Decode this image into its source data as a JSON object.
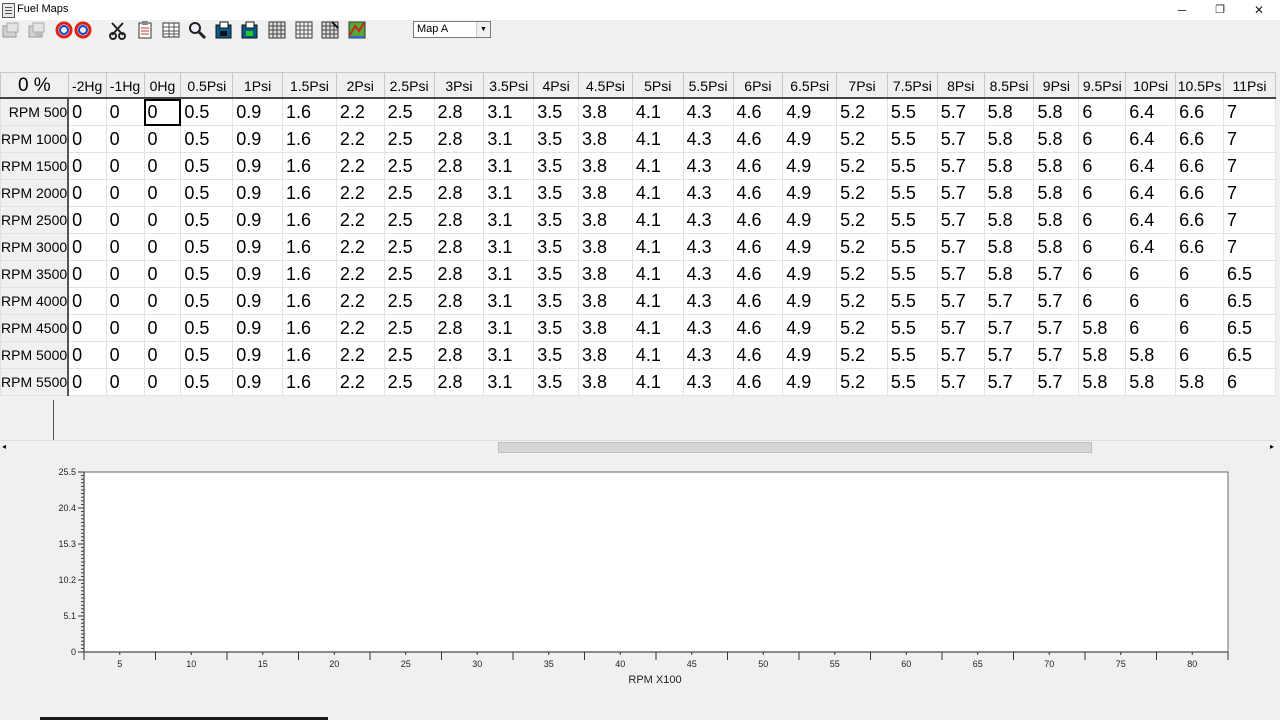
{
  "window": {
    "title": "Fuel Maps",
    "minimize": "─",
    "restore": "❐",
    "close": "✕"
  },
  "toolbar": {
    "icons": [
      "open-file-disabled-icon",
      "save-file-disabled-icon",
      "link-icon",
      "cut-icon",
      "clipboard-icon",
      "table-icon",
      "magnifier-icon",
      "load-map-icon",
      "save-map-icon",
      "grid-view-icon",
      "grid-icon",
      "grid-edit-icon",
      "chart-3d-icon"
    ],
    "map_select": {
      "value": "Map A",
      "arrow": "▼"
    }
  },
  "grid": {
    "corner": "0 %",
    "columns": [
      "-2Hg",
      "-1Hg",
      "0Hg",
      "0.5Psi",
      "1Psi",
      "1.5Psi",
      "2Psi",
      "2.5Psi",
      "3Psi",
      "3.5Psi",
      "4Psi",
      "4.5Psi",
      "5Psi",
      "5.5Psi",
      "6Psi",
      "6.5Psi",
      "7Psi",
      "7.5Psi",
      "8Psi",
      "8.5Psi",
      "9Psi",
      "9.5Psi",
      "10Psi",
      "10.5Ps",
      "11Psi"
    ],
    "rows": [
      {
        "label": "500 RPM",
        "values": [
          "0",
          "0",
          "0",
          "0.5",
          "0.9",
          "1.6",
          "2.2",
          "2.5",
          "2.8",
          "3.1",
          "3.5",
          "3.8",
          "4.1",
          "4.3",
          "4.6",
          "4.9",
          "5.2",
          "5.5",
          "5.7",
          "5.8",
          "5.8",
          "6",
          "6.4",
          "6.6",
          "7"
        ]
      },
      {
        "label": "1000 RPM",
        "values": [
          "0",
          "0",
          "0",
          "0.5",
          "0.9",
          "1.6",
          "2.2",
          "2.5",
          "2.8",
          "3.1",
          "3.5",
          "3.8",
          "4.1",
          "4.3",
          "4.6",
          "4.9",
          "5.2",
          "5.5",
          "5.7",
          "5.8",
          "5.8",
          "6",
          "6.4",
          "6.6",
          "7"
        ]
      },
      {
        "label": "1500 RPM",
        "values": [
          "0",
          "0",
          "0",
          "0.5",
          "0.9",
          "1.6",
          "2.2",
          "2.5",
          "2.8",
          "3.1",
          "3.5",
          "3.8",
          "4.1",
          "4.3",
          "4.6",
          "4.9",
          "5.2",
          "5.5",
          "5.7",
          "5.8",
          "5.8",
          "6",
          "6.4",
          "6.6",
          "7"
        ]
      },
      {
        "label": "2000 RPM",
        "values": [
          "0",
          "0",
          "0",
          "0.5",
          "0.9",
          "1.6",
          "2.2",
          "2.5",
          "2.8",
          "3.1",
          "3.5",
          "3.8",
          "4.1",
          "4.3",
          "4.6",
          "4.9",
          "5.2",
          "5.5",
          "5.7",
          "5.8",
          "5.8",
          "6",
          "6.4",
          "6.6",
          "7"
        ]
      },
      {
        "label": "2500 RPM",
        "values": [
          "0",
          "0",
          "0",
          "0.5",
          "0.9",
          "1.6",
          "2.2",
          "2.5",
          "2.8",
          "3.1",
          "3.5",
          "3.8",
          "4.1",
          "4.3",
          "4.6",
          "4.9",
          "5.2",
          "5.5",
          "5.7",
          "5.8",
          "5.8",
          "6",
          "6.4",
          "6.6",
          "7"
        ]
      },
      {
        "label": "3000 RPM",
        "values": [
          "0",
          "0",
          "0",
          "0.5",
          "0.9",
          "1.6",
          "2.2",
          "2.5",
          "2.8",
          "3.1",
          "3.5",
          "3.8",
          "4.1",
          "4.3",
          "4.6",
          "4.9",
          "5.2",
          "5.5",
          "5.7",
          "5.8",
          "5.8",
          "6",
          "6.4",
          "6.6",
          "7"
        ]
      },
      {
        "label": "3500 RPM",
        "values": [
          "0",
          "0",
          "0",
          "0.5",
          "0.9",
          "1.6",
          "2.2",
          "2.5",
          "2.8",
          "3.1",
          "3.5",
          "3.8",
          "4.1",
          "4.3",
          "4.6",
          "4.9",
          "5.2",
          "5.5",
          "5.7",
          "5.8",
          "5.7",
          "6",
          "6",
          "6",
          "6.5"
        ]
      },
      {
        "label": "4000 RPM",
        "values": [
          "0",
          "0",
          "0",
          "0.5",
          "0.9",
          "1.6",
          "2.2",
          "2.5",
          "2.8",
          "3.1",
          "3.5",
          "3.8",
          "4.1",
          "4.3",
          "4.6",
          "4.9",
          "5.2",
          "5.5",
          "5.7",
          "5.7",
          "5.7",
          "6",
          "6",
          "6",
          "6.5"
        ]
      },
      {
        "label": "4500 RPM",
        "values": [
          "0",
          "0",
          "0",
          "0.5",
          "0.9",
          "1.6",
          "2.2",
          "2.5",
          "2.8",
          "3.1",
          "3.5",
          "3.8",
          "4.1",
          "4.3",
          "4.6",
          "4.9",
          "5.2",
          "5.5",
          "5.7",
          "5.7",
          "5.7",
          "5.8",
          "6",
          "6",
          "6.5"
        ]
      },
      {
        "label": "5000 RPM",
        "values": [
          "0",
          "0",
          "0",
          "0.5",
          "0.9",
          "1.6",
          "2.2",
          "2.5",
          "2.8",
          "3.1",
          "3.5",
          "3.8",
          "4.1",
          "4.3",
          "4.6",
          "4.9",
          "5.2",
          "5.5",
          "5.7",
          "5.7",
          "5.7",
          "5.8",
          "5.8",
          "6",
          "6.5"
        ]
      },
      {
        "label": "5500 RPM",
        "values": [
          "0",
          "0",
          "0",
          "0.5",
          "0.9",
          "1.6",
          "2.2",
          "2.5",
          "2.8",
          "3.1",
          "3.5",
          "3.8",
          "4.1",
          "4.3",
          "4.6",
          "4.9",
          "5.2",
          "5.5",
          "5.7",
          "5.7",
          "5.7",
          "5.8",
          "5.8",
          "5.8",
          "6"
        ]
      }
    ],
    "selected": {
      "row": 0,
      "col": 2
    }
  },
  "scrollbar": {
    "left_arrow": "◂",
    "right_arrow": "▸"
  },
  "chart_data": {
    "type": "line",
    "title": "",
    "xlabel": "RPM X100",
    "ylabel": "",
    "x_ticks": [
      5,
      10,
      15,
      20,
      25,
      30,
      35,
      40,
      45,
      50,
      55,
      60,
      65,
      70,
      75,
      80
    ],
    "y_ticks": [
      0,
      5.1,
      10.2,
      15.3,
      20.4,
      25.5
    ],
    "ylim": [
      0,
      25.5
    ],
    "series": []
  },
  "colors": {
    "background": "#f0f0f0",
    "cell": "#ffffff",
    "grid_line": "#e2e2e2",
    "chart_bg": "#ffffff"
  }
}
